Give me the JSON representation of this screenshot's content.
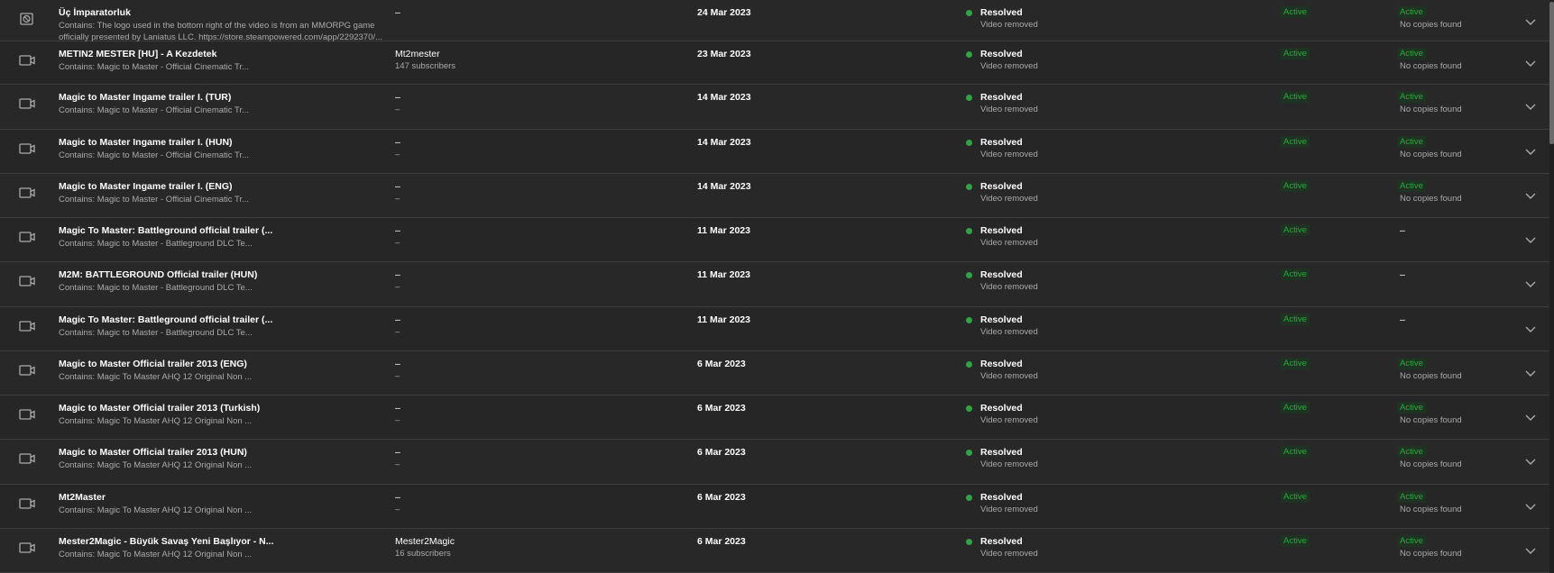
{
  "rows": [
    {
      "icon": "block-icon",
      "title": "Üç İmparatorluk",
      "desc": "Contains: The logo used in the bottom right of the video is from an MMORPG game officially presented by Laniatus LLC. https://store.steampowered.com/app/2292370/...",
      "channel": "–",
      "channel_sub": "",
      "date": "24 Mar 2023",
      "status": "Resolved",
      "status_sub": "Video removed",
      "badge1": "Active",
      "badge2": "Active",
      "copies": "No copies found"
    },
    {
      "icon": "video-icon",
      "title": "METIN2 MESTER [HU] - A Kezdetek",
      "desc": "Contains: Magic to Master - Official Cinematic Tr...",
      "channel": "Mt2mester",
      "channel_sub": "147 subscribers",
      "date": "23 Mar 2023",
      "status": "Resolved",
      "status_sub": "Video removed",
      "badge1": "Active",
      "badge2": "Active",
      "copies": "No copies found"
    },
    {
      "icon": "video-icon",
      "title": "Magic to Master Ingame trailer I. (TUR)",
      "desc": "Contains: Magic to Master - Official Cinematic Tr...",
      "channel": "–",
      "channel_sub": "–",
      "date": "14 Mar 2023",
      "status": "Resolved",
      "status_sub": "Video removed",
      "badge1": "Active",
      "badge2": "Active",
      "copies": "No copies found"
    },
    {
      "icon": "video-icon",
      "title": "Magic to Master Ingame trailer I. (HUN)",
      "desc": "Contains: Magic to Master - Official Cinematic Tr...",
      "channel": "–",
      "channel_sub": "–",
      "date": "14 Mar 2023",
      "status": "Resolved",
      "status_sub": "Video removed",
      "badge1": "Active",
      "badge2": "Active",
      "copies": "No copies found"
    },
    {
      "icon": "video-icon",
      "title": "Magic to Master Ingame trailer I. (ENG)",
      "desc": "Contains: Magic to Master - Official Cinematic Tr...",
      "channel": "–",
      "channel_sub": "–",
      "date": "14 Mar 2023",
      "status": "Resolved",
      "status_sub": "Video removed",
      "badge1": "Active",
      "badge2": "Active",
      "copies": "No copies found"
    },
    {
      "icon": "video-icon",
      "title": "Magic To Master: Battleground official trailer (...",
      "desc": "Contains: Magic to Master - Battleground DLC Te...",
      "channel": "–",
      "channel_sub": "–",
      "date": "11 Mar 2023",
      "status": "Resolved",
      "status_sub": "Video removed",
      "badge1": "Active",
      "badge2": "",
      "copies": "–"
    },
    {
      "icon": "video-icon",
      "title": "M2M: BATTLEGROUND Official trailer (HUN)",
      "desc": "Contains: Magic to Master - Battleground DLC Te...",
      "channel": "–",
      "channel_sub": "–",
      "date": "11 Mar 2023",
      "status": "Resolved",
      "status_sub": "Video removed",
      "badge1": "Active",
      "badge2": "",
      "copies": "–"
    },
    {
      "icon": "video-icon",
      "title": "Magic To Master: Battleground official trailer (...",
      "desc": "Contains: Magic to Master - Battleground DLC Te...",
      "channel": "–",
      "channel_sub": "–",
      "date": "11 Mar 2023",
      "status": "Resolved",
      "status_sub": "Video removed",
      "badge1": "Active",
      "badge2": "",
      "copies": "–"
    },
    {
      "icon": "video-icon",
      "title": "Magic to Master Official trailer 2013 (ENG)",
      "desc": "Contains: Magic To Master AHQ 12 Original Non ...",
      "channel": "–",
      "channel_sub": "–",
      "date": "6 Mar 2023",
      "status": "Resolved",
      "status_sub": "Video removed",
      "badge1": "Active",
      "badge2": "Active",
      "copies": "No copies found"
    },
    {
      "icon": "video-icon",
      "title": "Magic to Master Official trailer 2013 (Turkish)",
      "desc": "Contains: Magic To Master AHQ 12 Original Non ...",
      "channel": "–",
      "channel_sub": "–",
      "date": "6 Mar 2023",
      "status": "Resolved",
      "status_sub": "Video removed",
      "badge1": "Active",
      "badge2": "Active",
      "copies": "No copies found"
    },
    {
      "icon": "video-icon",
      "title": "Magic to Master Official trailer 2013 (HUN)",
      "desc": "Contains: Magic To Master AHQ 12 Original Non ...",
      "channel": "–",
      "channel_sub": "–",
      "date": "6 Mar 2023",
      "status": "Resolved",
      "status_sub": "Video removed",
      "badge1": "Active",
      "badge2": "Active",
      "copies": "No copies found"
    },
    {
      "icon": "video-icon",
      "title": "Mt2Master",
      "desc": "Contains: Magic To Master AHQ 12 Original Non ...",
      "channel": "–",
      "channel_sub": "–",
      "date": "6 Mar 2023",
      "status": "Resolved",
      "status_sub": "Video removed",
      "badge1": "Active",
      "badge2": "Active",
      "copies": "No copies found"
    },
    {
      "icon": "video-icon",
      "title": "Mester2Magic - Büyük Savaş Yeni Başlıyor - N...",
      "desc": "Contains: Magic To Master AHQ 12 Original Non ...",
      "channel": "Mester2Magic",
      "channel_sub": "16 subscribers",
      "date": "6 Mar 2023",
      "status": "Resolved",
      "status_sub": "Video removed",
      "badge1": "Active",
      "badge2": "Active",
      "copies": "No copies found"
    }
  ],
  "colors": {
    "status_dot": "#2ba640",
    "badge_text": "#2ba640",
    "background": "#282828"
  }
}
